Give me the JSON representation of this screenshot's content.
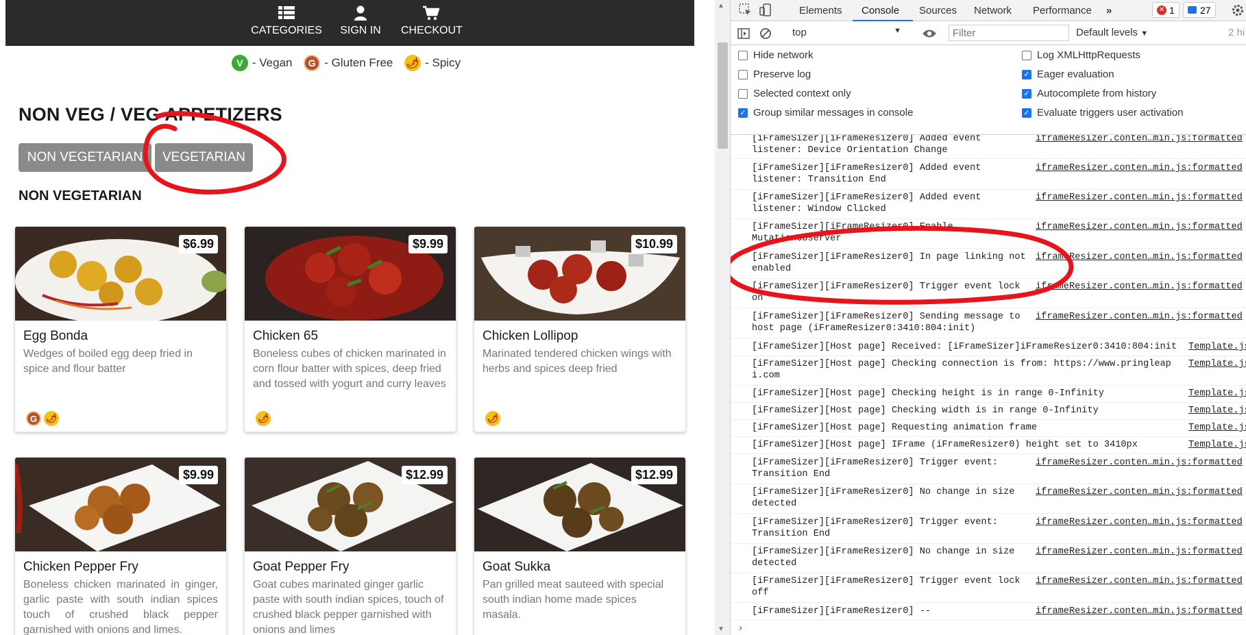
{
  "site": {
    "nav": [
      {
        "label": "CATEGORIES",
        "icon": "list-icon"
      },
      {
        "label": "SIGN IN",
        "icon": "user-icon"
      },
      {
        "label": "CHECKOUT",
        "icon": "cart-icon"
      }
    ],
    "legend": [
      {
        "symbol": "V",
        "label": "- Vegan",
        "kind": "vegan"
      },
      {
        "symbol": "G",
        "label": "- Gluten Free",
        "kind": "gluten-free"
      },
      {
        "symbol": "🌶",
        "label": "- Spicy",
        "kind": "spicy"
      }
    ],
    "page_title": "NON VEG / VEG APPETIZERS",
    "tabs": [
      "NON VEGETARIAN",
      "VEGETARIAN"
    ],
    "section_title": "NON VEGETARIAN",
    "items": [
      {
        "name": "Egg Bonda",
        "price": "$6.99",
        "desc": "Wedges of boiled egg deep fried in spice and flour batter",
        "badges": [
          "G",
          "🌶"
        ]
      },
      {
        "name": "Chicken 65",
        "price": "$9.99",
        "desc": "Boneless cubes of chicken marinated in corn flour batter with spices, deep fried and tossed with yogurt and curry leaves",
        "badges": [
          "🌶"
        ]
      },
      {
        "name": "Chicken Lollipop",
        "price": "$10.99",
        "desc": "Marinated tendered chicken wings with herbs and spices deep fried",
        "badges": [
          "🌶"
        ]
      },
      {
        "name": "Chicken Pepper Fry",
        "price": "$9.99",
        "desc": "Boneless chicken marinated in ginger, garlic paste with south indian spices touch of crushed black pepper garnished with onions and limes.",
        "badges": []
      },
      {
        "name": "Goat Pepper Fry",
        "price": "$12.99",
        "desc": "Goat cubes marinated ginger garlic paste with south indian spices, touch of crushed black pepper garnished with onions and limes",
        "badges": []
      },
      {
        "name": "Goat Sukka",
        "price": "$12.99",
        "desc": "Pan grilled meat sauteed with special south indian home made  spices masala.",
        "badges": []
      }
    ]
  },
  "devtools": {
    "tabs": [
      "Elements",
      "Console",
      "Sources",
      "Network",
      "Performance"
    ],
    "active_tab": "Console",
    "more_tabs": "»",
    "errors": "1",
    "messages": "27",
    "context": "top",
    "filter_placeholder": "Filter",
    "levels": "Default levels",
    "hidden_hint": "2 hi",
    "settings": [
      {
        "label": "Hide network",
        "checked": false
      },
      {
        "label": "Preserve log",
        "checked": false
      },
      {
        "label": "Selected context only",
        "checked": false
      },
      {
        "label": "Group similar messages in console",
        "checked": true
      },
      {
        "label": "Log XMLHttpRequests",
        "checked": false
      },
      {
        "label": "Eager evaluation",
        "checked": true
      },
      {
        "label": "Autocomplete from history",
        "checked": true
      },
      {
        "label": "Evaluate triggers user activation",
        "checked": true
      }
    ],
    "console": [
      {
        "text": "[iFrameSizer][iFrameResizer0] Added event\nlistener: Device Orientation Change",
        "src": "iframeResizer.conten…min.js:formatted"
      },
      {
        "text": "[iFrameSizer][iFrameResizer0] Added event\nlistener: Transition End",
        "src": "iframeResizer.conten…min.js:formatted"
      },
      {
        "text": "[iFrameSizer][iFrameResizer0] Added event\nlistener: Window Clicked",
        "src": "iframeResizer.conten…min.js:formatted"
      },
      {
        "text": "[iFrameSizer][iFrameResizer0] Enable\nMutationObserver",
        "src": "iframeResizer.conten…min.js:formatted"
      },
      {
        "text": "[iFrameSizer][iFrameResizer0] In page linking not\nenabled",
        "src": "iframeResizer.conten…min.js:formatted"
      },
      {
        "text": "[iFrameSizer][iFrameResizer0] Trigger event lock\non",
        "src": "iframeResizer.conten…min.js:formatted"
      },
      {
        "text": "[iFrameSizer][iFrameResizer0] Sending message to\nhost page (iFrameResizer0:3410:804:init)",
        "src": "iframeResizer.conten…min.js:formatted"
      },
      {
        "text": "[iFrameSizer][Host page] Received: [iFrameSizer]iFrameResizer0:3410:804:init",
        "src": "Template.js"
      },
      {
        "text": "[iFrameSizer][Host page] Checking connection is from: https://www.pringleap\ni.com",
        "src": "Template.js"
      },
      {
        "text": "[iFrameSizer][Host page] Checking height is in range 0-Infinity",
        "src": "Template.js"
      },
      {
        "text": "[iFrameSizer][Host page] Checking width is in range 0-Infinity",
        "src": "Template.js"
      },
      {
        "text": "[iFrameSizer][Host page] Requesting animation frame",
        "src": "Template.js"
      },
      {
        "text": "[iFrameSizer][Host page] IFrame (iFrameResizer0) height set to 3410px",
        "src": "Template.js"
      },
      {
        "text": "[iFrameSizer][iFrameResizer0] Trigger event:\nTransition End",
        "src": "iframeResizer.conten…min.js:formatted"
      },
      {
        "text": "[iFrameSizer][iFrameResizer0] No change in size\ndetected",
        "src": "iframeResizer.conten…min.js:formatted"
      },
      {
        "text": "[iFrameSizer][iFrameResizer0] Trigger event:\nTransition End",
        "src": "iframeResizer.conten…min.js:formatted"
      },
      {
        "text": "[iFrameSizer][iFrameResizer0] No change in size\ndetected",
        "src": "iframeResizer.conten…min.js:formatted"
      },
      {
        "text": "[iFrameSizer][iFrameResizer0] Trigger event lock\noff",
        "src": "iframeResizer.conten…min.js:formatted"
      },
      {
        "text": "[iFrameSizer][iFrameResizer0] --",
        "src": "iframeResizer.conten…min.js:formatted"
      }
    ],
    "prompt": "›"
  },
  "colors": {
    "topbar": "#2b2b2b",
    "tab_button": "#8a8a8a",
    "annotation": "#e8141c",
    "devtools_accent": "#1a73e8"
  }
}
